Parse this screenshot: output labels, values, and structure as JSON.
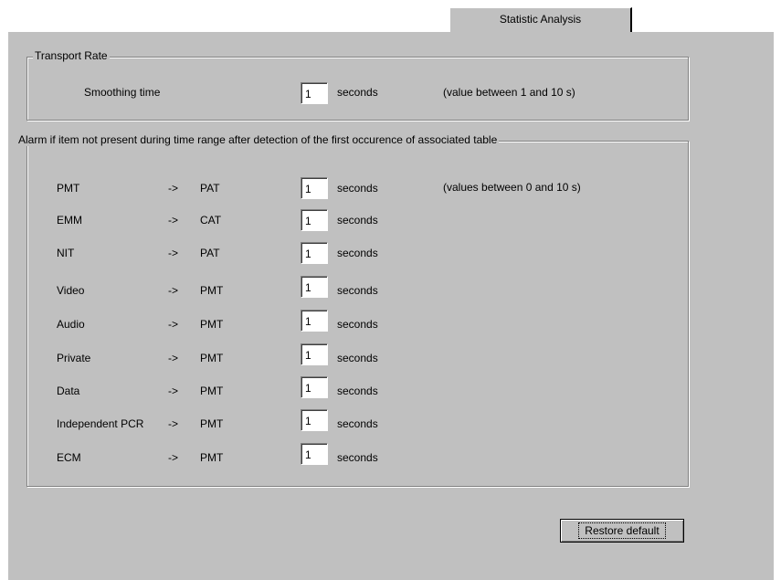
{
  "tabs": [
    {
      "label": "Statistic Analysis"
    }
  ],
  "transport_rate": {
    "title": "Transport Rate",
    "label": "Smoothing time",
    "value": "1",
    "unit": "seconds",
    "hint": "(value between 1 and 10 s)"
  },
  "alarm": {
    "title": "Alarm if item not present during time range after detection of the first occurence of associated table",
    "hint": "(values between 0 and 10 s)",
    "rows": [
      {
        "item": "PMT",
        "arrow": "->",
        "table": "PAT",
        "value": "1",
        "unit": "seconds"
      },
      {
        "item": "EMM",
        "arrow": "->",
        "table": "CAT",
        "value": "1",
        "unit": "seconds"
      },
      {
        "item": "NIT",
        "arrow": "->",
        "table": "PAT",
        "value": "1",
        "unit": "seconds"
      },
      {
        "item": "Video",
        "arrow": "->",
        "table": "PMT",
        "value": "1",
        "unit": "seconds"
      },
      {
        "item": "Audio",
        "arrow": "->",
        "table": "PMT",
        "value": "1",
        "unit": "seconds"
      },
      {
        "item": "Private",
        "arrow": "->",
        "table": "PMT",
        "value": "1",
        "unit": "seconds"
      },
      {
        "item": "Data",
        "arrow": "->",
        "table": "PMT",
        "value": "1",
        "unit": "seconds"
      },
      {
        "item": "Independent PCR",
        "arrow": "->",
        "table": "PMT",
        "value": "1",
        "unit": "seconds"
      },
      {
        "item": "ECM",
        "arrow": "->",
        "table": "PMT",
        "value": "1",
        "unit": "seconds"
      }
    ]
  },
  "buttons": {
    "restore_default": "Restore default"
  }
}
